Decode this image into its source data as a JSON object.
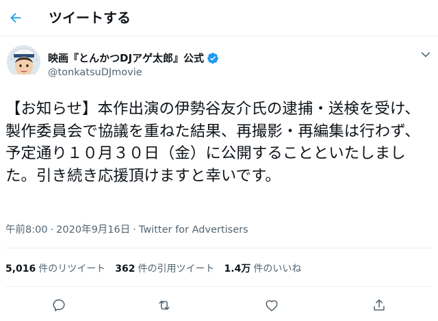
{
  "header": {
    "title": "ツイートする",
    "back_icon": "back-arrow-icon"
  },
  "colors": {
    "accent": "#1d9bf0",
    "muted": "#536471",
    "text": "#0f1419",
    "divider": "#ebeef0"
  },
  "tweet": {
    "display_name": "映画『とんかつDJアゲ太郎』公式",
    "handle": "@tonkatsuDJmovie",
    "text": "【お知らせ】本作出演の伊勢谷友介氏の逮捕・送検を受け、製作委員会で協議を重ねた結果、再撮影・再編集は行わず、予定通り１０月３０日（金）に公開することといたしました。引き続き応援頂けますと幸いです。",
    "time": "午前8:00",
    "date": "2020年9月16日",
    "separator": "·",
    "source": "Twitter for Advertisers"
  },
  "stats": {
    "retweets_count": "5,016",
    "retweets_label": "件のリツイート",
    "quotes_count": "362",
    "quotes_label": "件の引用ツイート",
    "likes_count": "1.4万",
    "likes_label": "件のいいね"
  },
  "actions": [
    "reply-icon",
    "retweet-icon",
    "like-icon",
    "share-icon"
  ]
}
